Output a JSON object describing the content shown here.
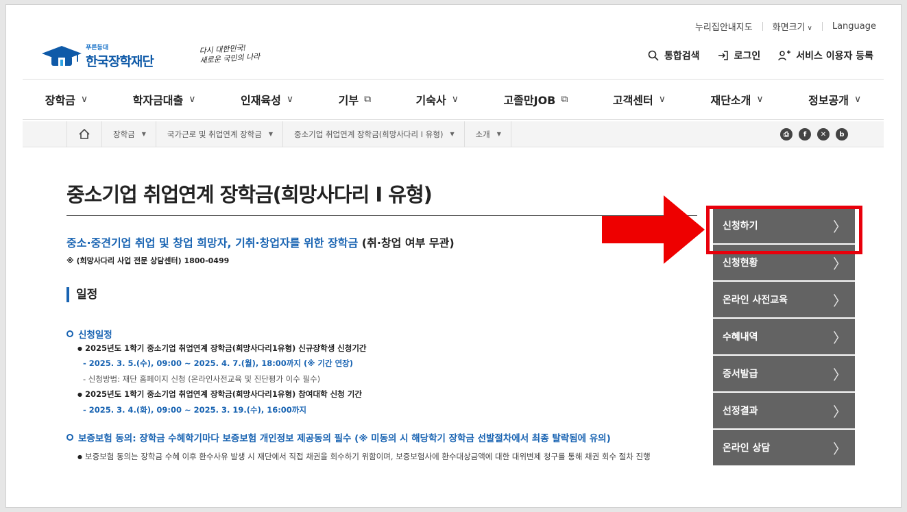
{
  "utility": {
    "sitemap": "누리집안내지도",
    "zoom": "화면크기",
    "language": "Language"
  },
  "logo": {
    "tagline": "푸른등대",
    "name": "한국장학재단",
    "slogan_line1": "다시 대한민국!",
    "slogan_line2": "새로운 국민의 나라"
  },
  "user_actions": {
    "search": "통합검색",
    "login": "로그인",
    "register": "서비스 이용자 등록"
  },
  "gnb": [
    "장학금",
    "학자금대출",
    "인재육성",
    "기부",
    "기숙사",
    "고졸만JOB",
    "고객센터",
    "재단소개",
    "정보공개"
  ],
  "breadcrumb": [
    "장학금",
    "국가근로 및 취업연계 장학금",
    "중소기업 취업연계 장학금(희망사다리 I 유형)",
    "소개"
  ],
  "share": [
    "print-icon",
    "facebook-icon",
    "x-icon",
    "blog-icon"
  ],
  "page": {
    "title": "중소기업 취업연계 장학금(희망사다리 I 유형)",
    "lead_blue": "중소·중견기업 취업 및 창업 희망자, 기취·창업자를 위한 장학금",
    "lead_black": " (취·창업 여부 무관)",
    "note": "※ (희망사다리 사업 전문 상담센터) 1800-0499",
    "section": "일정",
    "sub1": "신청일정",
    "b1": "2025년도 1학기 중소기업 취업연계 장학금(희망사다리1유형) 신규장학생 신청기간",
    "d1": "- 2025. 3. 5.(수), 09:00 ~ 2025. 4. 7.(월), 18:00까지 (※ 기간 연장)",
    "d2": "- 신청방법: 재단 홈페이지 신청 (온라인사전교육 및 진단평가 이수 필수)",
    "b2": "2025년도 1학기 중소기업 취업연계 장학금(희망사다리1유형) 참여대학 신청 기간",
    "d3": "- 2025. 3. 4.(화), 09:00 ~ 2025. 3. 19.(수), 16:00까지",
    "sub2": "보증보험 동의: 장학금 수혜학기마다 보증보험 개인정보 제공동의 필수 (※ 미동의 시 해당학기 장학금 선발절차에서 최종 탈락됨에 유의)",
    "b3": "보증보험 동의는 장학금 수혜 이후 환수사유 발생 시 재단에서 직접 채권을 회수하기 위함이며, 보증보험사에 환수대상금액에 대한 대위변제 청구를 통해 채권 회수 절차 진행"
  },
  "side_menu": [
    "신청하기",
    "신청현황",
    "온라인 사전교육",
    "수혜내역",
    "증서발급",
    "선정결과",
    "온라인 상담"
  ],
  "colors": {
    "accent": "#1863b2",
    "side": "#636363",
    "highlight": "#e8000b"
  }
}
